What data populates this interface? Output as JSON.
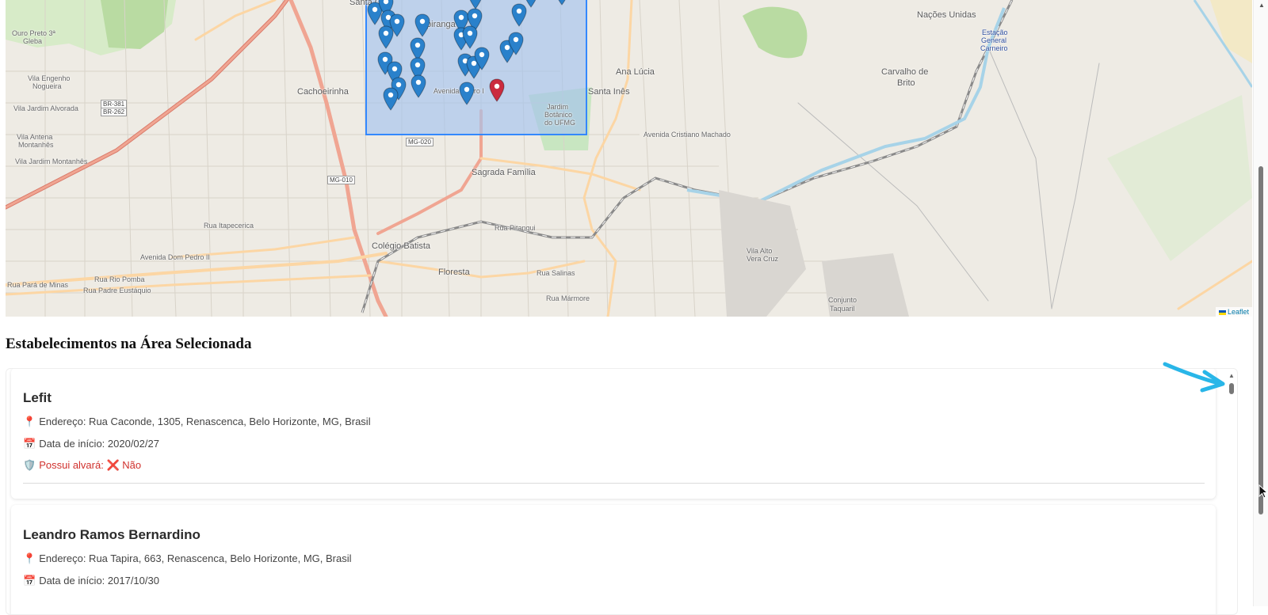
{
  "map": {
    "attribution": "Leaflet",
    "places": [
      {
        "name": "Santa Cruz",
        "cls": ""
      },
      {
        "name": "Ipiranga",
        "cls": ""
      },
      {
        "name": "Cachoeirinha",
        "cls": ""
      },
      {
        "name": "Ana Lúcia",
        "cls": ""
      },
      {
        "name": "Santa Inês",
        "cls": ""
      },
      {
        "name": "Sagrada Família",
        "cls": ""
      },
      {
        "name": "Colégio Batista",
        "cls": ""
      },
      {
        "name": "Floresta",
        "cls": ""
      },
      {
        "name": "Nações Unidas",
        "cls": ""
      },
      {
        "name": "Carvalho de",
        "cls": ""
      },
      {
        "name": "Brito",
        "cls": ""
      },
      {
        "name": "Conjunto",
        "cls": "small"
      },
      {
        "name": "Taquaril",
        "cls": "small"
      },
      {
        "name": "Vila Engenho",
        "cls": "small"
      },
      {
        "name": "Nogueira",
        "cls": "small"
      },
      {
        "name": "Vila Jardim Alvorada",
        "cls": "small"
      },
      {
        "name": "Vila Antena",
        "cls": "small"
      },
      {
        "name": "Montanhês",
        "cls": "small"
      },
      {
        "name": "Vila Jardim Montanhês",
        "cls": "small"
      },
      {
        "name": "Ouro Preto 3ª",
        "cls": "small"
      },
      {
        "name": "Gleba",
        "cls": "small"
      },
      {
        "name": "Jardim",
        "cls": "small"
      },
      {
        "name": "Botânico",
        "cls": "small"
      },
      {
        "name": "do UFMG",
        "cls": "small"
      },
      {
        "name": "Vila Alto",
        "cls": "small"
      },
      {
        "name": "Vera Cruz",
        "cls": "small"
      },
      {
        "name": "Estação",
        "cls": "small"
      },
      {
        "name": "General",
        "cls": "small"
      },
      {
        "name": "Carneiro",
        "cls": "small"
      }
    ],
    "shields": [
      "BR-381",
      "BR-262",
      "MG-020",
      "MG-010"
    ],
    "streets": [
      "Rua Pará de Minas",
      "Rua Rio Pomba",
      "Rua Padre Eustáquio",
      "Avenida Dom Pedro II",
      "Rua Itapecerica",
      "Avenida Pedro I",
      "Rua Pitangui",
      "Rua Salinas",
      "Rua Mármore",
      "Avenida Cristiano Machado"
    ]
  },
  "section": {
    "title": "Estabelecimentos na Área Selecionada"
  },
  "establishments": [
    {
      "name": "Lefit",
      "address_icon": "📍",
      "address": "Endereço: Rua Caconde, 1305, Renascenca, Belo Horizonte, MG, Brasil",
      "date_icon": "📅",
      "date": "Data de início: 2020/02/27",
      "alvara_icon": "🛡️",
      "alvara_label": "Possui alvará:",
      "alvara_status_icon": "❌",
      "alvara_value": "Não"
    },
    {
      "name": "Leandro Ramos Bernardino",
      "address_icon": "📍",
      "address": "Endereço: Rua Tapira, 663, Renascenca, Belo Horizonte, MG, Brasil",
      "date_icon": "📅",
      "date": "Data de início: 2017/10/30"
    }
  ],
  "colors": {
    "marker_blue": "#2a81cb",
    "marker_red": "#cb2b3e",
    "selection_fill": "#a5c3ee",
    "selection_stroke": "#3388ff",
    "alvara_no": "#d0312d",
    "annotation_arrow": "#29b6e8"
  },
  "icons": {
    "map_marker": "map-pin-icon",
    "selected_marker": "map-pin-selected-icon",
    "address": "pin-icon",
    "date": "calendar-icon",
    "alvara": "shield-icon",
    "no": "cross-icon"
  }
}
